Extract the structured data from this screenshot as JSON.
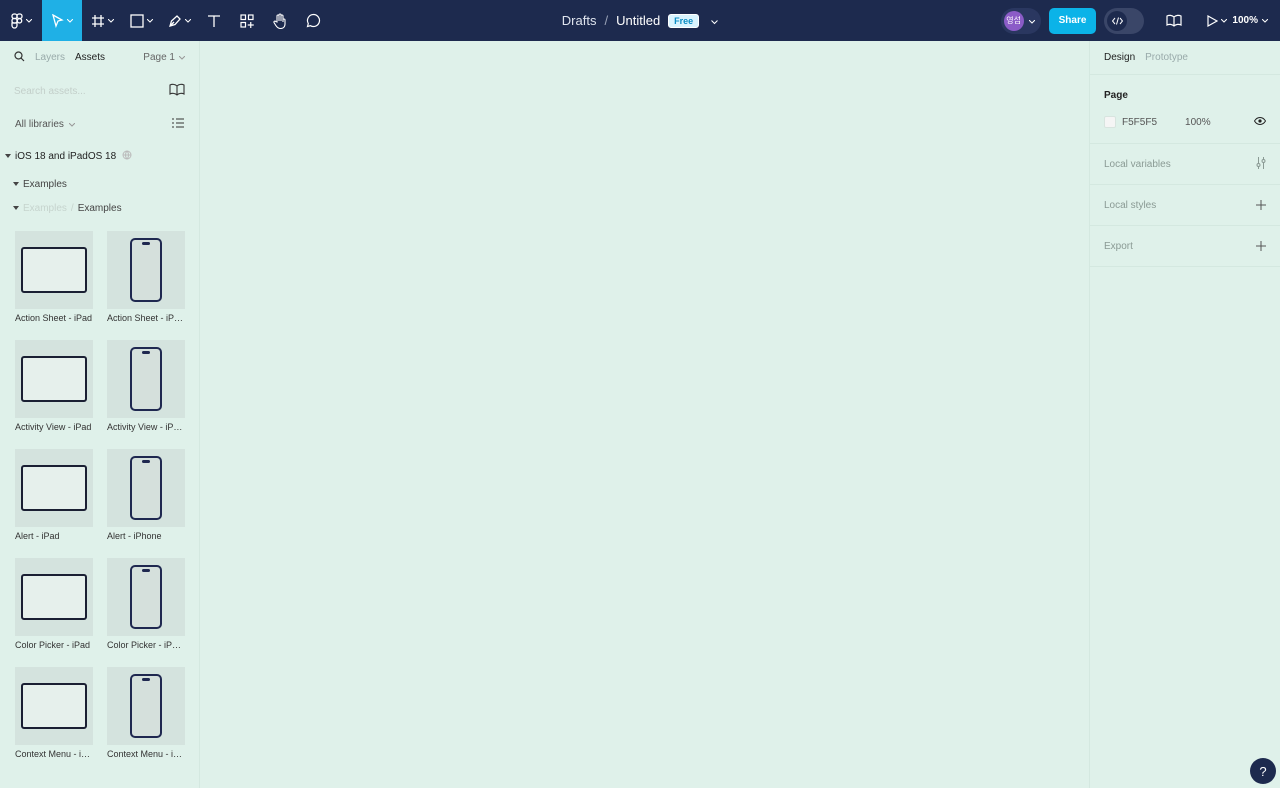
{
  "toolbar": {
    "tools": [
      {
        "name": "figma-menu-icon"
      },
      {
        "name": "move-tool-icon",
        "active": true
      },
      {
        "name": "frame-tool-icon"
      },
      {
        "name": "shape-tool-icon"
      },
      {
        "name": "pen-tool-icon"
      },
      {
        "name": "text-tool-icon"
      },
      {
        "name": "resources-icon"
      },
      {
        "name": "hand-tool-icon"
      },
      {
        "name": "comment-tool-icon"
      }
    ],
    "breadcrumb_folder": "Drafts",
    "breadcrumb_sep": "/",
    "file_name": "Untitled",
    "plan_badge": "Free",
    "avatar_initials": "영섭",
    "share_label": "Share",
    "zoom_label": "100%",
    "accent_color": "#1fb0e6",
    "bar_color": "#1d2a4e"
  },
  "left_panel": {
    "tab_layers": "Layers",
    "tab_assets": "Assets",
    "page_selector": "Page 1",
    "search_placeholder": "Search assets...",
    "libraries_filter": "All libraries",
    "library_name": "iOS 18 and iPadOS 18",
    "section": "Examples",
    "crumb_parent": "Examples",
    "crumb_sep": "/",
    "crumb_current": "Examples",
    "assets": [
      {
        "label": "Action Sheet - iPad",
        "device": "ipad"
      },
      {
        "label": "Action Sheet - iPhone",
        "device": "iphone"
      },
      {
        "label": "Activity View - iPad",
        "device": "ipad"
      },
      {
        "label": "Activity View - iPhone",
        "device": "iphone"
      },
      {
        "label": "Alert - iPad",
        "device": "ipad"
      },
      {
        "label": "Alert - iPhone",
        "device": "iphone"
      },
      {
        "label": "Color Picker - iPad",
        "device": "ipad"
      },
      {
        "label": "Color Picker - iPhone",
        "device": "iphone"
      },
      {
        "label": "Context Menu - iPad",
        "device": "ipad"
      },
      {
        "label": "Context Menu - iPhone",
        "device": "iphone"
      }
    ]
  },
  "right_panel": {
    "tab_design": "Design",
    "tab_prototype": "Prototype",
    "page_heading": "Page",
    "page_color_hex": "F5F5F5",
    "page_opacity": "100%",
    "local_variables": "Local variables",
    "local_styles": "Local styles",
    "export": "Export"
  },
  "canvas": {
    "background": "#dff1ea"
  },
  "help_label": "?"
}
